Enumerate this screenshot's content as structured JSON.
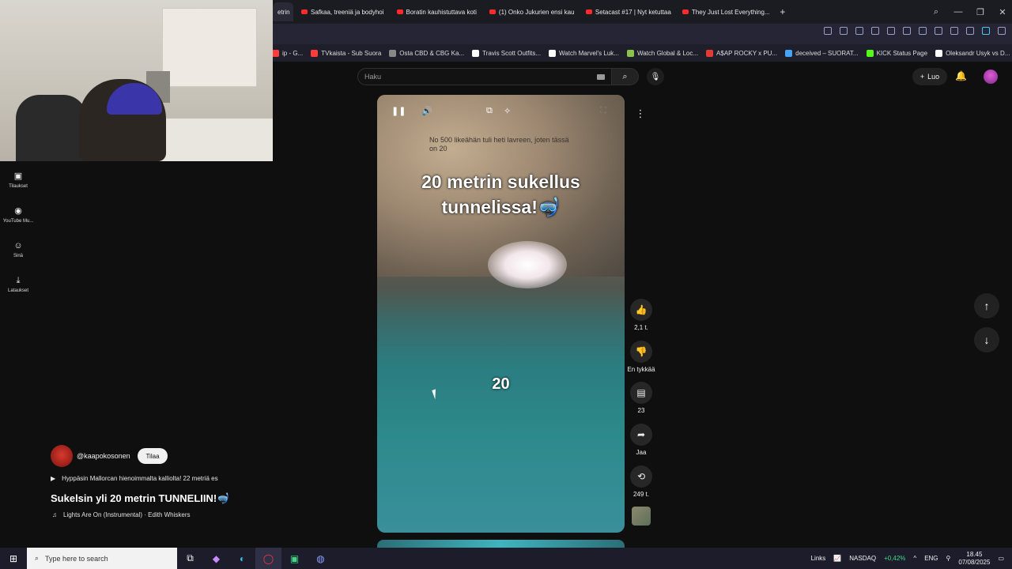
{
  "browser": {
    "tabs": [
      {
        "label": "etrin",
        "active": true
      },
      {
        "label": "Safkaa, treeniä ja bodyhoi"
      },
      {
        "label": "Boratin kauhistuttava koti"
      },
      {
        "label": "(1) Onko Jukurien ensi kau"
      },
      {
        "label": "Setacast #17 | Nyt ketuttaa"
      },
      {
        "label": "They Just Lost Everything..."
      }
    ],
    "new_tab": "+",
    "bookmarks": [
      {
        "label": "ip - G...",
        "color": "#ff3b3b"
      },
      {
        "label": "TVkaista - Sub Suora",
        "color": "#ff3b3b"
      },
      {
        "label": "Osta CBD & CBG Ka...",
        "color": "#888888"
      },
      {
        "label": "Travis Scott Outfits...",
        "color": "#ffffff"
      },
      {
        "label": "Watch Marvel's Luk...",
        "color": "#ffffff"
      },
      {
        "label": "Watch Global & Loc...",
        "color": "#8bc34a"
      },
      {
        "label": "A$AP ROCKY x PU...",
        "color": "#e53935"
      },
      {
        "label": "deceived – SUORAT...",
        "color": "#42a5f5"
      },
      {
        "label": "KICK Status Page",
        "color": "#53fc18"
      },
      {
        "label": "Oleksandr Usyk vs D...",
        "color": "#ffffff"
      }
    ]
  },
  "sidebar": {
    "items": [
      {
        "label": "Tilaukset",
        "icon": "subscriptions-icon",
        "glyph": "▣"
      },
      {
        "label": "YouTube Mu...",
        "icon": "youtube-music-icon",
        "glyph": "◉"
      },
      {
        "label": "Sinä",
        "icon": "you-icon",
        "glyph": "☺"
      },
      {
        "label": "Lataukset",
        "icon": "download-icon",
        "glyph": "⤓"
      }
    ]
  },
  "header": {
    "search_placeholder": "Haku",
    "create_label": "Luo"
  },
  "video": {
    "caption": "No 500 likeähän tuli heti lavreen, joten tässä on 20",
    "title_line1": "20 metrin sukellus",
    "title_line2": "tunnelissa!🤿",
    "overlay_number": "20"
  },
  "actions": {
    "likes": "2,1 t.",
    "dislike_label": "En tykkää",
    "comments": "23",
    "share_label": "Jaa",
    "remix": "249 t."
  },
  "channel": {
    "handle": "@kaapokosonen",
    "subscribe_label": "Tilaa",
    "description": "Hyppäsin Mallorcan hienoimmalta kalliolta! 22 metriä es",
    "short_title": "Sukelsin yli 20 metrin TUNNELIIN!🤿",
    "music": "Lights Are On (Instrumental) · Edith Whiskers"
  },
  "taskbar": {
    "search_placeholder": "Type here to search",
    "links_label": "Links",
    "ticker_name": "NASDAQ",
    "ticker_change": "+0,42%",
    "lang": "ENG",
    "time": "18.45",
    "date": "07/08/2025"
  },
  "colors": {
    "background": "#0f0f0f",
    "accent_red": "#ff0000",
    "ticker_green": "#3ddc84"
  }
}
